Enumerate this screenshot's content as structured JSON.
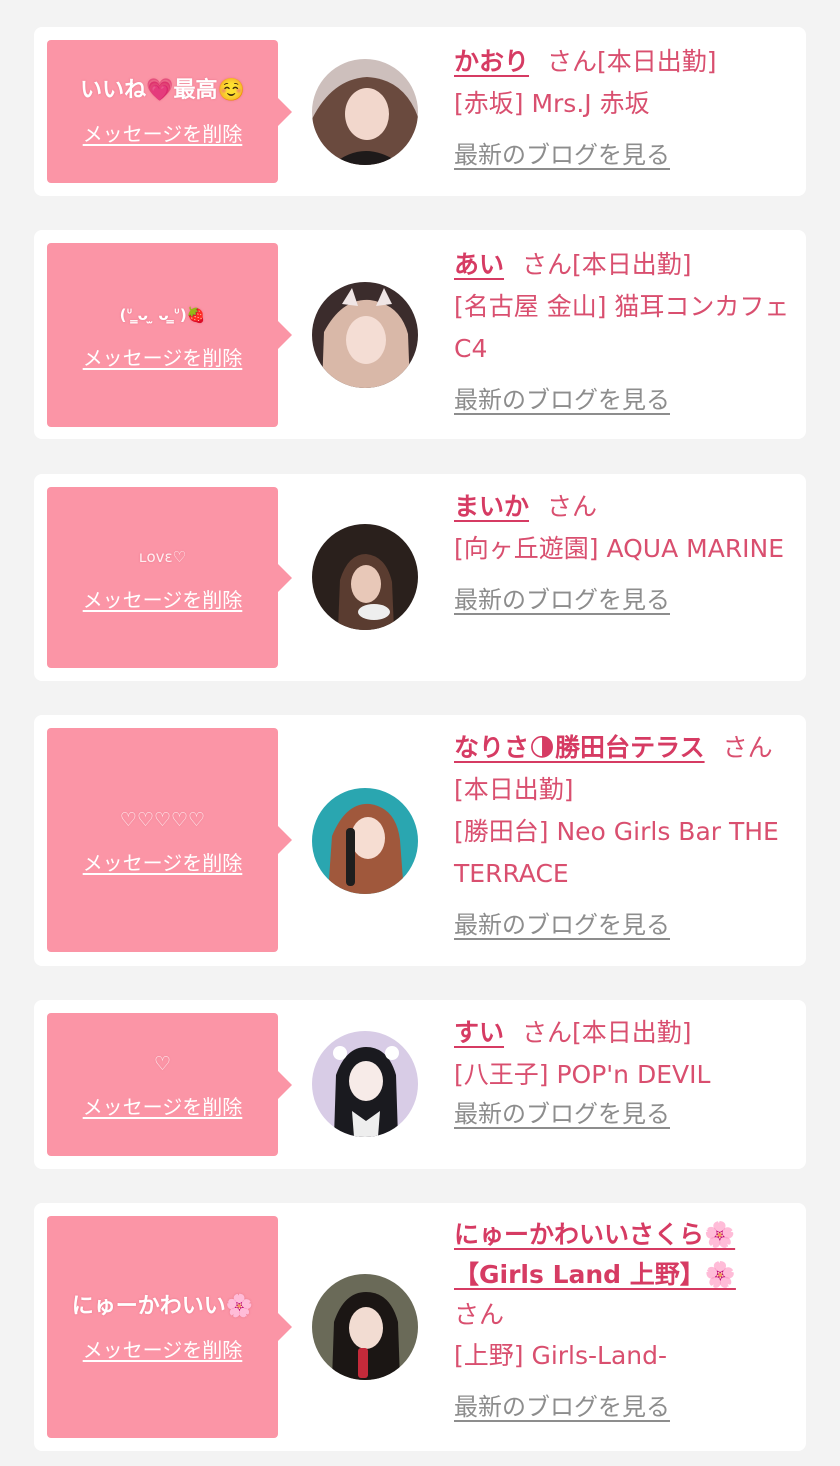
{
  "cards": [
    {
      "message": "いいね💗最高☺️",
      "delete_label": "メッセージを削除",
      "name": "かおり",
      "san": "さん",
      "status": "[本日出勤]",
      "shop": "[赤坂] Mrs.J 赤坂",
      "blog_label": "最新のブログを見る",
      "avatar_color": "#6a4a3e"
    },
    {
      "message": "(ᐡ ̳ᴗ ̫ ᴗ ̳ᐡ)🍓",
      "delete_label": "メッセージを削除",
      "name": "あい",
      "san": "さん",
      "status": "[本日出勤]",
      "shop": "[名古屋 金山] 猫耳コンカフェ C4",
      "blog_label": "最新のブログを見る",
      "avatar_color": "#8a6a6a"
    },
    {
      "message": "ʟovε♡",
      "delete_label": "メッセージを削除",
      "name": "まいか",
      "san": "さん",
      "status": "",
      "shop": "[向ヶ丘遊園] AQUA MARINE",
      "blog_label": "最新のブログを見る",
      "avatar_color": "#3a2c28"
    },
    {
      "message": "♡♡♡♡♡",
      "delete_label": "メッセージを削除",
      "name": "なりさ🌗勝田台テラス",
      "san": "さ",
      "status": "ん[本日出勤]",
      "shop": "[勝田台] Neo Girls Bar THE TERRACE",
      "blog_label": "最新のブログを見る",
      "avatar_color": "#2aa6b0"
    },
    {
      "message": "♡",
      "delete_label": "メッセージを削除",
      "name": "すい",
      "san": "さん",
      "status": "[本日出勤]",
      "shop": "[八王子] POP'n DEVIL",
      "blog_label": "最新のブログを見る",
      "avatar_color": "#d8cce6"
    },
    {
      "message": "にゅーかわいい🌸",
      "delete_label": "メッセージを削除",
      "name": "にゅーかわいいさくら🌸【Girls Land 上野】🌸",
      "san": "さん",
      "status": "",
      "shop": "[上野] Girls-Land-",
      "blog_label": "最新のブログを見る",
      "avatar_color": "#4a4a3a"
    }
  ]
}
